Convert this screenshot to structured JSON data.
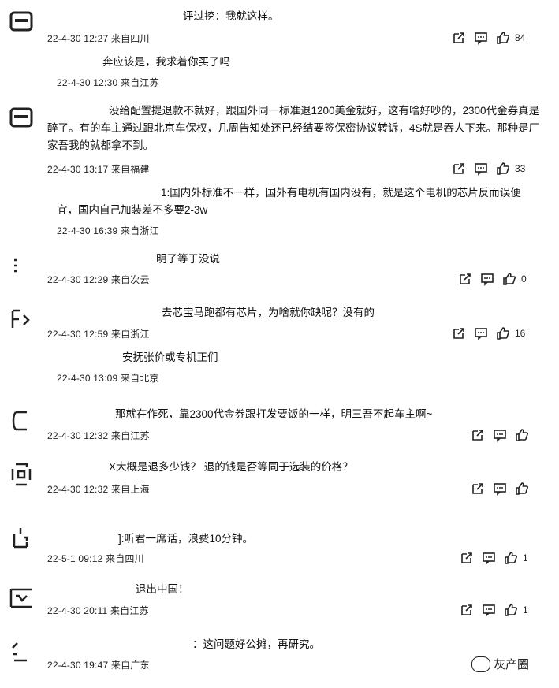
{
  "comments": [
    {
      "name": "",
      "text": "评过挖：我就这样。",
      "meta": "22-4-30 12:27 来自四川",
      "likes": "84"
    },
    {
      "reply": true,
      "text": "奔应该是，我求着你买了吗",
      "meta": "22-4-30 12:30 来自江苏"
    },
    {
      "text": "没给配置提退款不就好，跟国外同一标准退1200美金就好，这有啥好吵的，2300代金券真是醉了。有的车主通过跟北京车保权，几周告知处还已经结要签保密协议转诉，4S就是吞人下来。那种是厂家吾我的就都拿不到。",
      "meta": "22-4-30 13:17 来自福建",
      "likes": "33"
    },
    {
      "reply": true,
      "text": "1:国内外标准不一样，国外有电机有国内没有，就是这个电机的芯片反而误便宜，国内自己加装差不多要2-3w",
      "meta": "22-4-30 16:39 来自浙江"
    },
    {
      "text": "明了等于没说",
      "meta": "22-4-30 12:29 来自次云",
      "likes": "0"
    },
    {
      "text": "去芯宝马跑都有芯片，为啥就你缺呢？没有的",
      "meta": "22-4-30 12:59 来自浙江",
      "likes": "16"
    },
    {
      "reply": true,
      "text": "安抚张价或专机正们",
      "meta": "22-4-30 13:09 来自北京"
    },
    {
      "text": "那就在作死，靠2300代金券跟打发要饭的一样，明三吾不起车主啊~",
      "meta": "22-4-30 12:32 来自江苏"
    },
    {
      "text": "X大概是退多少钱？ 退的钱是否等同于选装的价格？",
      "meta": "22-4-30 12:32 来自上海"
    },
    {
      "text": "]:听君一席话，浪费10分钟。",
      "meta": "22-5-1 09:12 来自四川",
      "likes": "1"
    },
    {
      "text": "退出中国！",
      "meta": "22-4-30 20:11 来自江苏",
      "likes": "1"
    },
    {
      "text": "：这问题好公摊，再研究。",
      "meta": "22-4-30 19:47 来自广东"
    }
  ],
  "watermark": {
    "text": "灰产圈"
  },
  "icons": {
    "share": "share-icon",
    "comment": "comment-icon",
    "like": "like-icon"
  }
}
